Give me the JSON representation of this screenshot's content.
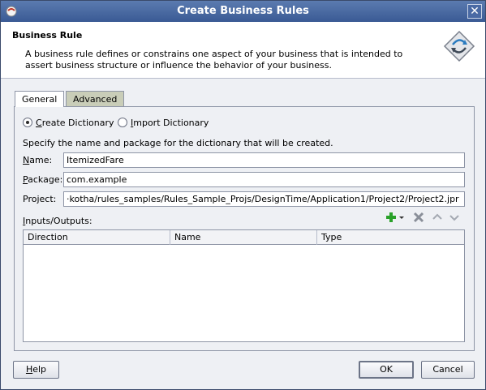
{
  "window": {
    "title": "Create Business Rules",
    "close_glyph": "✕"
  },
  "header": {
    "title": "Business Rule",
    "description": "A business rule defines or constrains one aspect of your business that is intended to assert business structure or influence the behavior of your business.",
    "icon": "business-rule-diamond-icon"
  },
  "tabs": [
    {
      "label": "General",
      "active": true
    },
    {
      "label": "Advanced",
      "active": false
    }
  ],
  "radios": {
    "create": {
      "label_mnemonic": "C",
      "label_rest": "reate Dictionary",
      "selected": true
    },
    "import": {
      "label_mnemonic": "I",
      "label_rest": "mport Dictionary",
      "selected": false
    }
  },
  "instructions": "Specify the name and package for the dictionary that will be created.",
  "fields": {
    "name": {
      "label_mnemonic": "N",
      "label_rest": "ame:",
      "value": "ItemizedFare"
    },
    "package": {
      "label_mnemonic": "P",
      "label_rest": "ackage:",
      "value": "com.example"
    },
    "project": {
      "label": "Project:",
      "value": "·kotha/rules_samples/Rules_Sample_Projs/DesignTime/Application1/Project2/Project2.jpr"
    }
  },
  "io": {
    "label_mnemonic": "I",
    "label_rest": "nputs/Outputs:",
    "columns": [
      "Direction",
      "Name",
      "Type"
    ],
    "rows": []
  },
  "toolbar_icons": [
    "add-icon",
    "dropdown-arrow-icon",
    "delete-icon",
    "move-up-icon",
    "move-down-icon"
  ],
  "colors": {
    "titlebar": "#3a5a94",
    "tab_inactive": "#c9cdb8",
    "add_green": "#2aa12a"
  },
  "buttons": {
    "help": {
      "mnemonic": "H",
      "rest": "elp"
    },
    "ok": "OK",
    "cancel": "Cancel"
  }
}
